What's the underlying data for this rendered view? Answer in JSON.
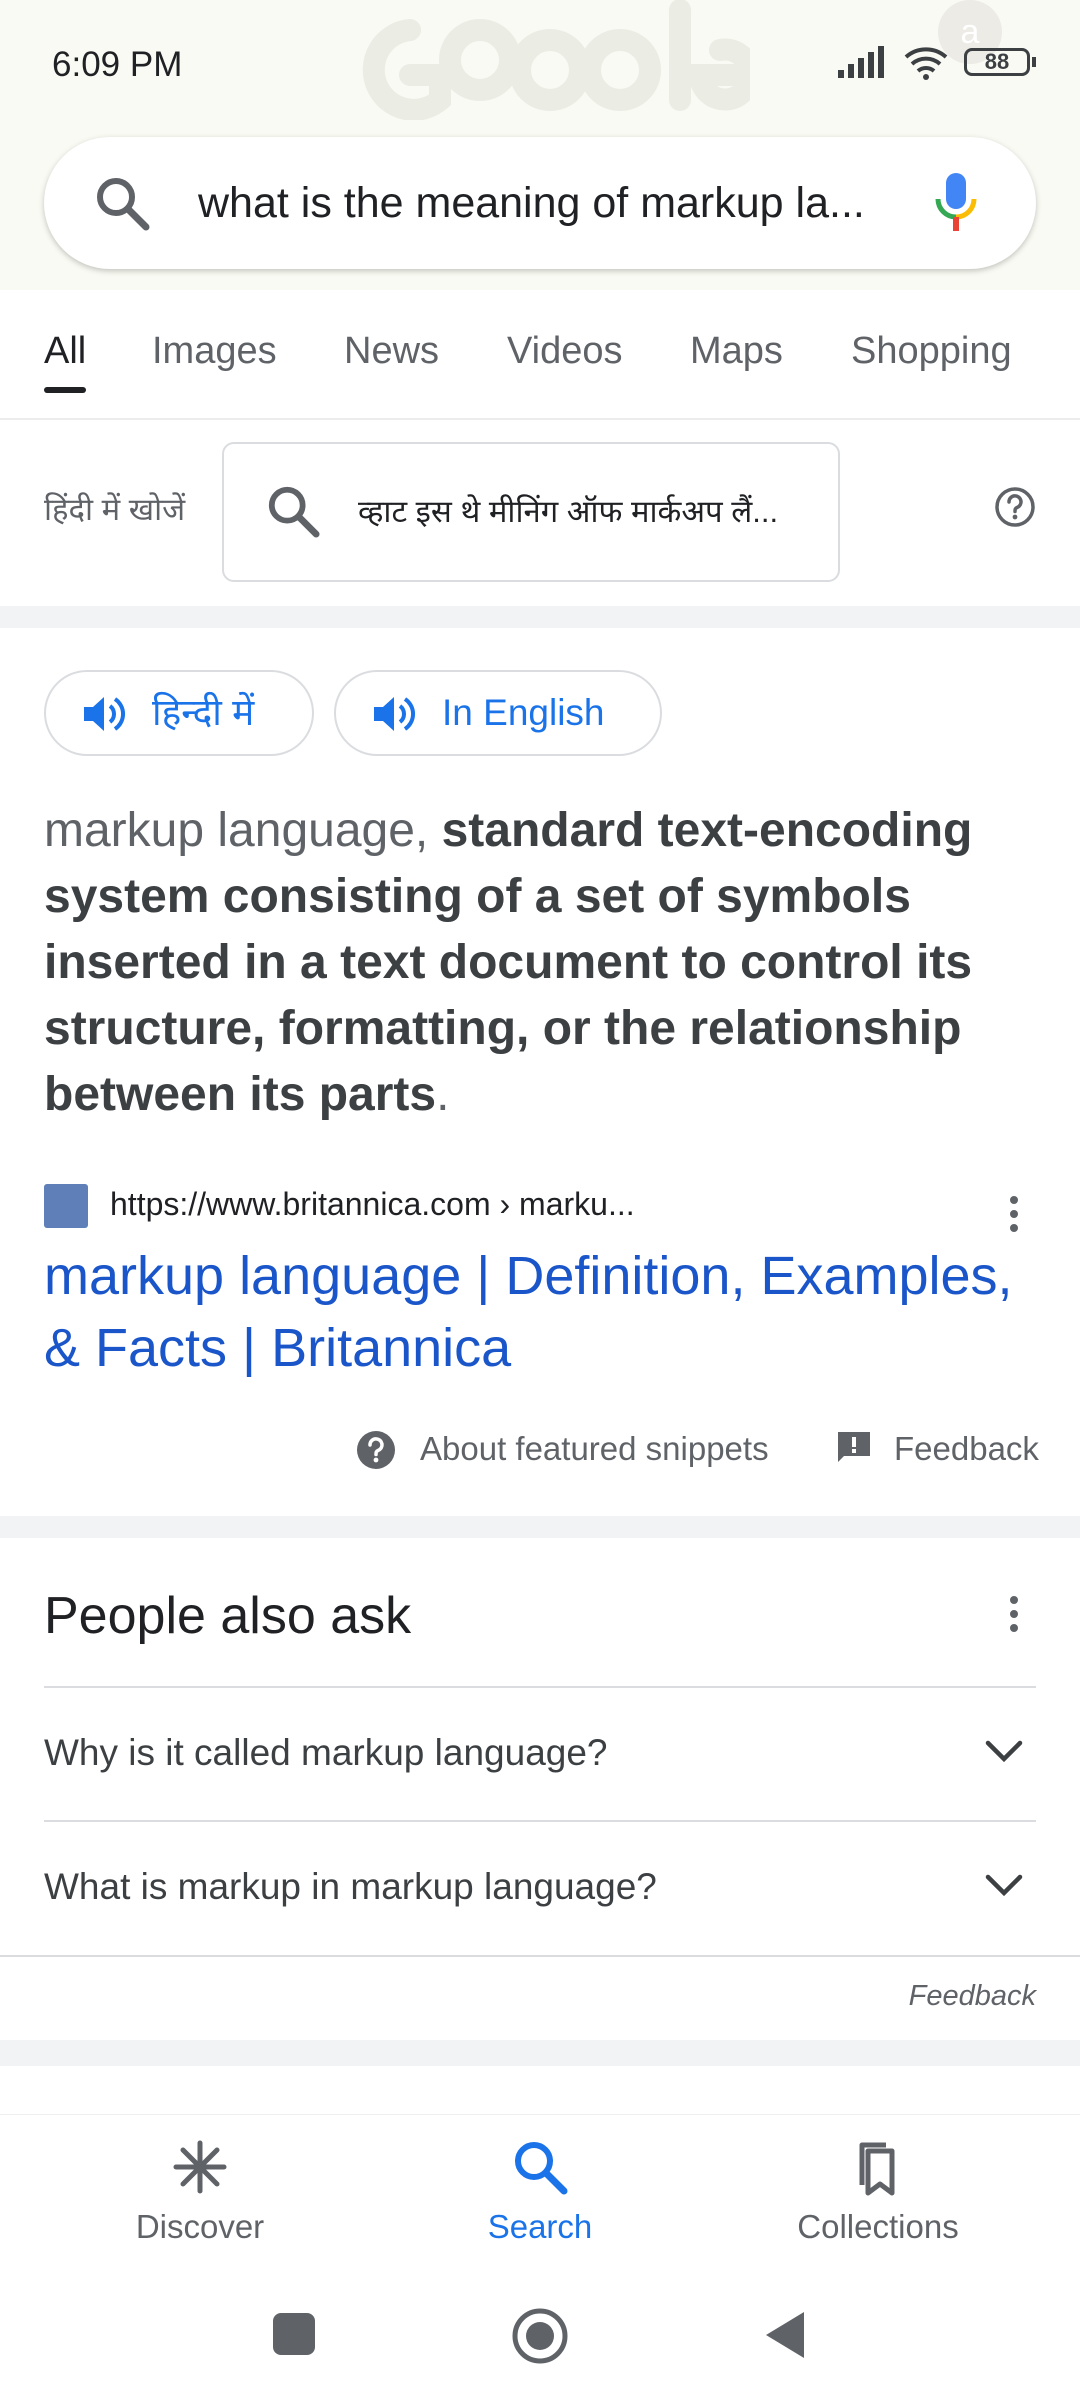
{
  "status": {
    "time": "6:09 PM",
    "battery": "88"
  },
  "account": {
    "initial": "a"
  },
  "search": {
    "query": "what is the meaning of markup la..."
  },
  "tabs": [
    {
      "label": "All"
    },
    {
      "label": "Images"
    },
    {
      "label": "News"
    },
    {
      "label": "Videos"
    },
    {
      "label": "Maps"
    },
    {
      "label": "Shopping"
    }
  ],
  "hindi_search": {
    "label": "हिंदी में खोजें",
    "query": "व्हाट इस थे मीनिंग ऑफ मार्कअप लैं..."
  },
  "speak_buttons": {
    "hindi": "हिन्दी में",
    "english": "In English"
  },
  "snippet": {
    "term": "markup language,",
    "definition": "standard text-encoding system consisting of a set of symbols inserted in a text document to control its structure, formatting, or the relationship between its parts",
    "end": "."
  },
  "result": {
    "url": "https://www.britannica.com › marku...",
    "title": "markup language | Definition, Examples, & Facts | Britannica"
  },
  "snippet_footer": {
    "about": "About featured snippets",
    "feedback": "Feedback"
  },
  "people_also_ask": {
    "title": "People also ask",
    "questions": [
      "Why is it called markup language?",
      "What is markup in markup language?"
    ],
    "feedback": "Feedback"
  },
  "bottom_nav": {
    "discover": "Discover",
    "search": "Search",
    "collections": "Collections"
  },
  "colors": {
    "link": "#1a56c9",
    "accent": "#1a73e8"
  }
}
